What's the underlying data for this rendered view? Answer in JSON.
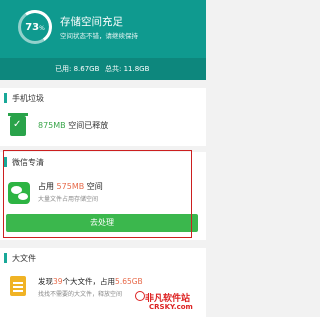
{
  "header": {
    "gauge_value": "73",
    "gauge_unit": "%",
    "title": "存储空间充足",
    "subtitle": "空间状态不错，请继续保持",
    "used": "已用: 8.67GB",
    "total": "总共: 11.8GB"
  },
  "sections": {
    "trash": {
      "title": "手机垃圾",
      "freed_amount": "875MB",
      "freed_label": " 空间已释放"
    },
    "wechat": {
      "title": "微信专清",
      "occupy_prefix": "占用 ",
      "occupy_amount": "575MB",
      "occupy_suffix": " 空间",
      "desc": "大量文件占用存储空间",
      "button": "去处理"
    },
    "bigfiles": {
      "title": "大文件",
      "found_prefix": "发现",
      "found_count": "39",
      "found_mid": "个大文件，占用",
      "found_amount": "5.65GB",
      "desc": "找找不需要的大文件，释放空间"
    }
  },
  "watermark": {
    "line1": "非凡软件站",
    "line2": "CRSKY.com"
  },
  "colors": {
    "header": "#0f9a8f",
    "accent_green": "#3bb74d",
    "highlight": "#e76a4a",
    "annotation_red": "#cc1f1f"
  }
}
